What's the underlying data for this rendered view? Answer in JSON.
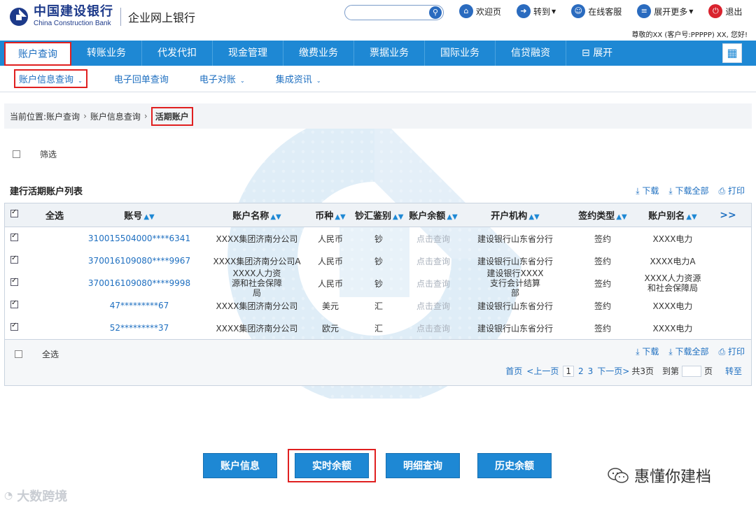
{
  "header": {
    "bank_name_cn": "中国建设银行",
    "bank_name_en": "China Construction Bank",
    "product": "企业网上银行",
    "search_placeholder": "",
    "links": [
      {
        "label": "欢迎页",
        "icon": "home-icon"
      },
      {
        "label": "转到",
        "icon": "forward-icon",
        "dropdown": true
      },
      {
        "label": "在线客服",
        "icon": "user-service-icon"
      },
      {
        "label": "展开更多",
        "icon": "list-icon",
        "dropdown": true
      },
      {
        "label": "退出",
        "icon": "power-icon"
      }
    ],
    "greeting": "尊敬的XX (客户号:PPPPP) XX, 您好!"
  },
  "main_nav": {
    "items": [
      "账户查询",
      "转账业务",
      "代发代扣",
      "现金管理",
      "缴费业务",
      "票据业务",
      "国际业务",
      "信贷融资"
    ],
    "expand_label": "展开",
    "active_index": 0
  },
  "sub_nav": {
    "items": [
      "账户信息查询",
      "电子回单查询",
      "电子对账",
      "集成资讯"
    ],
    "active_index": 0
  },
  "breadcrumb": {
    "prefix": "当前位置:",
    "items": [
      "账户查询",
      "账户信息查询",
      "活期账户"
    ]
  },
  "filter": {
    "label": "筛选"
  },
  "section": {
    "title": "建行活期账户列表"
  },
  "actions": {
    "download": "下载",
    "download_all": "下载全部",
    "print": "打印"
  },
  "table": {
    "select_all": "全选",
    "columns": [
      "账号",
      "账户名称",
      "币种",
      "钞汇鉴别",
      "账户余额",
      "开户机构",
      "签约类型",
      "账户别名"
    ],
    "more": ">>",
    "rows": [
      {
        "account": "310015504000****6341",
        "name": "XXXX集团济南分公司",
        "currency": "人民币",
        "type": "钞",
        "balance": "点击查询",
        "branch": "建设银行山东省分行",
        "sign": "签约",
        "alias": "XXXX电力"
      },
      {
        "account": "370016109080****9967",
        "name": "XXXX集团济南分公司A",
        "currency": "人民币",
        "type": "钞",
        "balance": "点击查询",
        "branch": "建设银行山东省分行",
        "sign": "签约",
        "alias": "XXXX电力A"
      },
      {
        "account": "370016109080****9998",
        "name": "XXXX人力资源和社会保障局",
        "currency": "人民币",
        "type": "钞",
        "balance": "点击查询",
        "branch": "建设银行XXXX支行会计结算部",
        "sign": "签约",
        "alias": "XXXX人力资源和社会保障局"
      },
      {
        "account": "47*********67",
        "name": "XXXX集团济南分公司",
        "currency": "美元",
        "type": "汇",
        "balance": "点击查询",
        "branch": "建设银行山东省分行",
        "sign": "签约",
        "alias": "XXXX电力"
      },
      {
        "account": "52*********37",
        "name": "XXXX集团济南分公司",
        "currency": "欧元",
        "type": "汇",
        "balance": "点击查询",
        "branch": "建设银行山东省分行",
        "sign": "签约",
        "alias": "XXXX电力"
      }
    ]
  },
  "footer": {
    "select_all": "全选"
  },
  "pager": {
    "first": "首页",
    "prev": "<上一页",
    "current": "1",
    "pages": [
      "2",
      "3"
    ],
    "next": "下一页>",
    "total": "共3页",
    "goto_prefix": "到第",
    "goto_suffix": "页",
    "go": "转至"
  },
  "buttons": [
    "账户信息",
    "实时余额",
    "明细查询",
    "历史余额"
  ],
  "highlighted_button": 1,
  "wechat_brand": "惠懂你建档",
  "corner_brand": "大数跨境",
  "colors": {
    "primary": "#1e88d4",
    "link": "#1e6fc0",
    "highlight": "#e02020",
    "logo": "#1d3a8a"
  }
}
